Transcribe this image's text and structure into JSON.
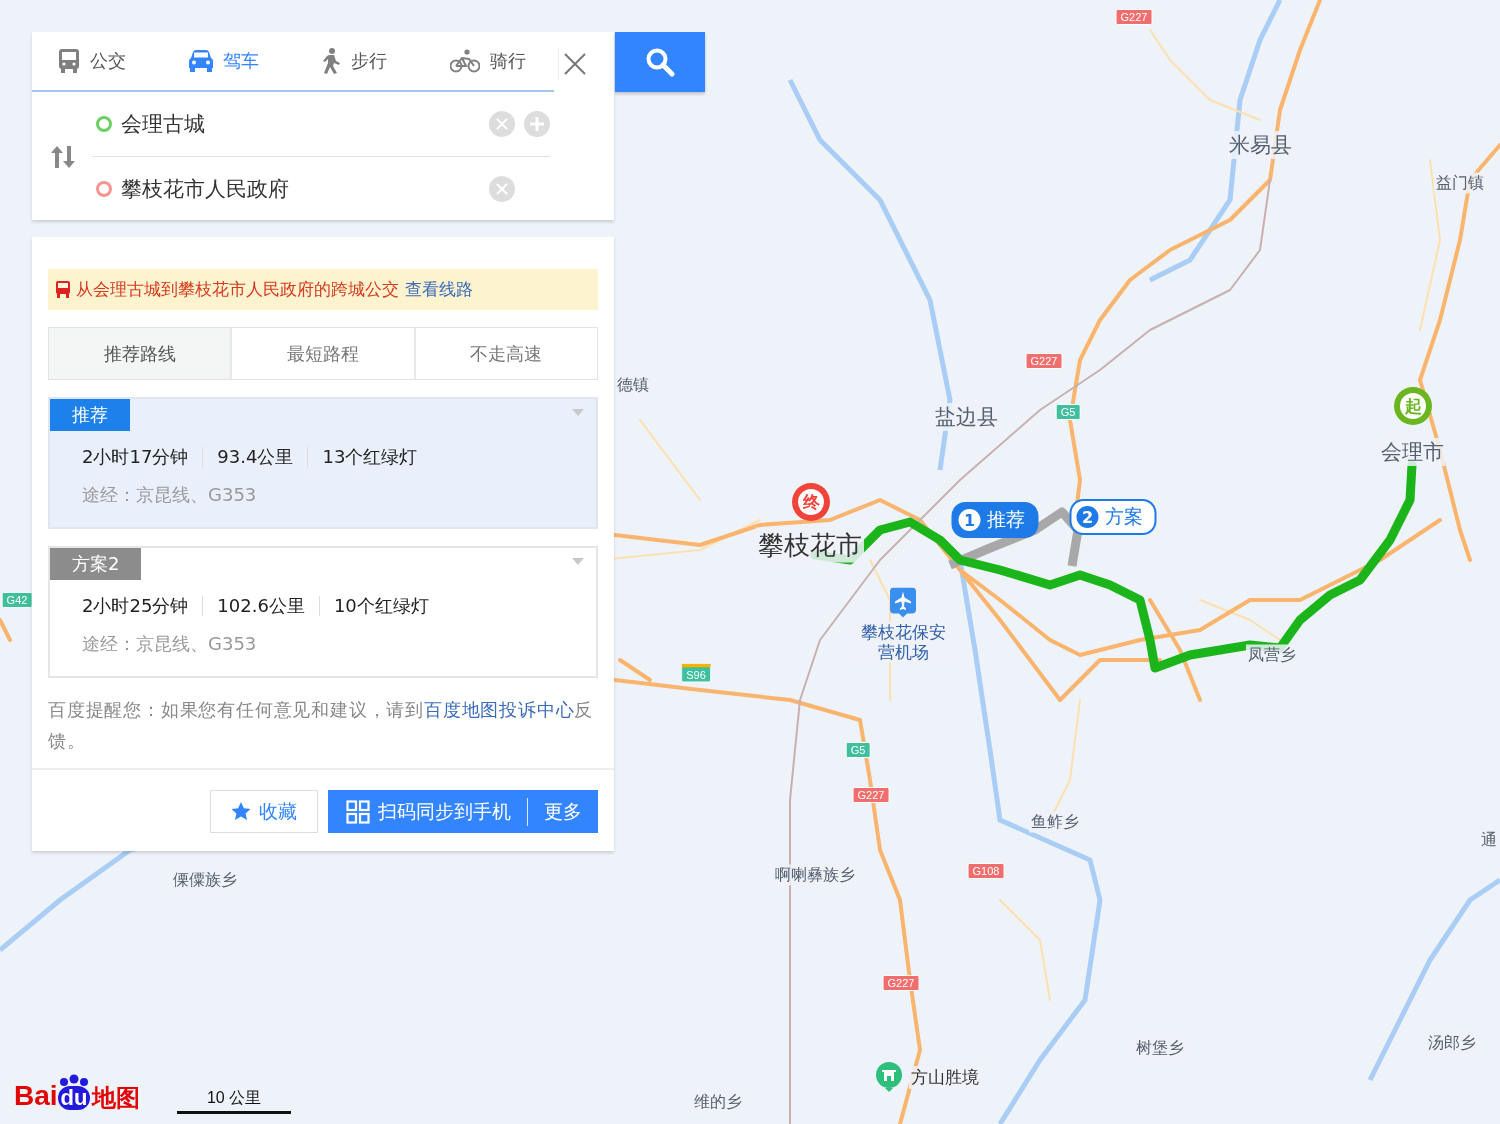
{
  "mode_tabs": [
    {
      "label": "公交",
      "kind": "bus",
      "selected": false
    },
    {
      "label": "驾车",
      "kind": "car",
      "selected": true
    },
    {
      "label": "步行",
      "kind": "walk",
      "selected": false
    },
    {
      "label": "骑行",
      "kind": "bike",
      "selected": false
    }
  ],
  "route": {
    "start": "会理古城",
    "end": "攀枝花市人民政府"
  },
  "notice": {
    "text": "从会理古城到攀枝花市人民政府的跨城公交",
    "link": "查看线路"
  },
  "preference_tabs": [
    {
      "label": "推荐路线",
      "selected": true
    },
    {
      "label": "最短路程",
      "selected": false
    },
    {
      "label": "不走高速",
      "selected": false
    }
  ],
  "plans": [
    {
      "tag": "推荐",
      "selected": true,
      "duration": "2小时17分钟",
      "distance": "93.4公里",
      "lights": "13个红绿灯",
      "via": "途经：京昆线、G353"
    },
    {
      "tag": "方案2",
      "selected": false,
      "duration": "2小时25分钟",
      "distance": "102.6公里",
      "lights": "10个红绿灯",
      "via": "途经：京昆线、G353"
    }
  ],
  "tip": {
    "text": "百度提醒您：如果您有任何意见和建议，请到",
    "link": "百度地图投诉中心",
    "tail": "反馈。"
  },
  "actions": {
    "favorite": "收藏",
    "sync": "扫码同步到手机",
    "more": "更多"
  },
  "map": {
    "places": [
      {
        "label": "米易县",
        "kind": "county"
      },
      {
        "label": "益门镇",
        "kind": "town"
      },
      {
        "label": "盐边县",
        "kind": "county"
      },
      {
        "label": "德镇",
        "kind": "town"
      },
      {
        "label": "攀枝花市",
        "kind": "city"
      },
      {
        "label": "会理市",
        "kind": "county"
      },
      {
        "label": "凤营乡",
        "kind": "town"
      },
      {
        "label": "鱼鲊乡",
        "kind": "town"
      },
      {
        "label": "啊喇彝族乡",
        "kind": "town"
      },
      {
        "label": "傈僳族乡",
        "kind": "town"
      },
      {
        "label": "维的乡",
        "kind": "town"
      },
      {
        "label": "树堡乡",
        "kind": "town"
      },
      {
        "label": "汤郎乡",
        "kind": "town"
      },
      {
        "label": "通",
        "kind": "town"
      }
    ],
    "road_shields": [
      {
        "label": "G227",
        "kind": "national"
      },
      {
        "label": "G227",
        "kind": "national"
      },
      {
        "label": "G5",
        "kind": "expressway"
      },
      {
        "label": "S96",
        "kind": "provincial"
      },
      {
        "label": "G5",
        "kind": "expressway"
      },
      {
        "label": "G227",
        "kind": "national"
      },
      {
        "label": "G108",
        "kind": "national"
      },
      {
        "label": "G227",
        "kind": "national"
      },
      {
        "label": "G42",
        "kind": "expressway"
      }
    ],
    "end_marker": "终",
    "start_marker": "起",
    "callouts": [
      {
        "number": "1",
        "label": "推荐",
        "selected": true
      },
      {
        "number": "2",
        "label": "方案",
        "selected": false
      }
    ],
    "pois": [
      {
        "label": "攀枝花保安营机场",
        "kind": "airport"
      },
      {
        "label": "方山胜境",
        "kind": "scenic"
      }
    ],
    "logo": {
      "bai": "Bai",
      "du": "du",
      "suffix": "地图"
    },
    "scale": "10 公里"
  }
}
